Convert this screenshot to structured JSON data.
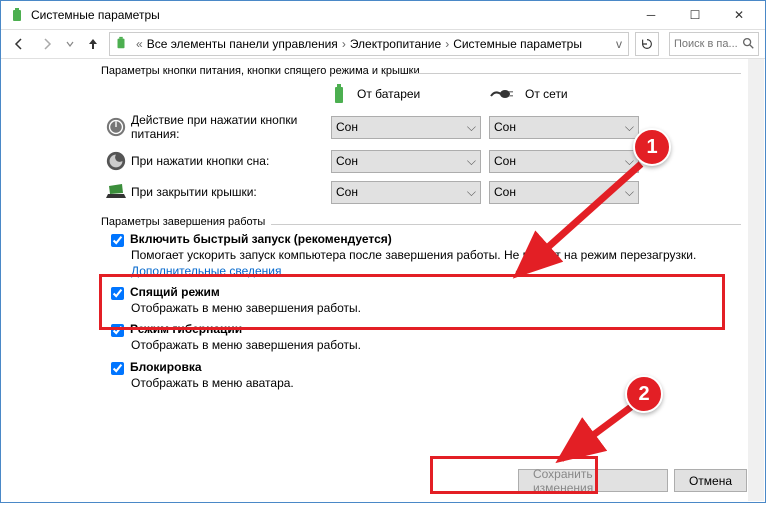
{
  "window": {
    "title": "Системные параметры"
  },
  "breadcrumb": {
    "root": "Все элементы панели управления",
    "mid": "Электропитание",
    "leaf": "Системные параметры"
  },
  "search": {
    "placeholder": "Поиск в па..."
  },
  "section1": {
    "title": "Параметры кнопки питания, кнопки спящего режима и крышки",
    "col_battery": "От батареи",
    "col_ac": "От сети",
    "rows": [
      {
        "label": "Действие при нажатии кнопки питания:",
        "battery": "Сон",
        "ac": "Сон"
      },
      {
        "label": "При нажатии кнопки сна:",
        "battery": "Сон",
        "ac": "Сон"
      },
      {
        "label": "При закрытии крышки:",
        "battery": "Сон",
        "ac": "Сон"
      }
    ]
  },
  "section2": {
    "title": "Параметры завершения работы",
    "items": [
      {
        "title": "Включить быстрый запуск (рекомендуется)",
        "desc": "Помогает ускорить запуск компьютера после завершения работы. Не влияет на режим перезагрузки.",
        "link": "Дополнительные сведения"
      },
      {
        "title": "Спящий режим",
        "desc": "Отображать в меню завершения работы."
      },
      {
        "title": "Режим гибернации",
        "desc": "Отображать в меню завершения работы."
      },
      {
        "title": "Блокировка",
        "desc": "Отображать в меню аватара."
      }
    ]
  },
  "footer": {
    "save": "Сохранить изменения",
    "cancel": "Отмена"
  },
  "annotations": {
    "badge1": "1",
    "badge2": "2"
  }
}
